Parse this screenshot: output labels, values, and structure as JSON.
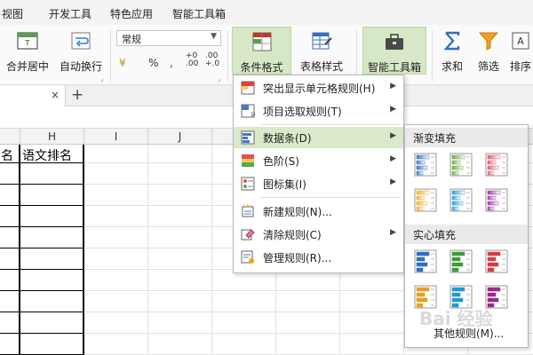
{
  "menu_tabs": [
    "视图",
    "开发工具",
    "特色应用",
    "智能工具箱"
  ],
  "ribbon": {
    "merge_center": "合并居中",
    "wrap_text": "自动换行",
    "number_format": "常规",
    "format_symbols": {
      "percent": "%",
      "comma": ",",
      "increase_decimal": "+0\n.00",
      "decrease_decimal": ".00\n+.0",
      "currency": "¥"
    },
    "conditional_format": "条件格式",
    "table_style": "表格样式",
    "smart_toolbox": "智能工具箱",
    "sum": "求和",
    "filter": "筛选",
    "sort": "排序"
  },
  "doc_tab": {
    "close": "×",
    "add": "+"
  },
  "columns": [
    "H",
    "I",
    "J"
  ],
  "cells": {
    "g_header": "名",
    "h_header": "语文排名"
  },
  "cf_menu": [
    {
      "label": "突出显示单元格规则(H)",
      "submenu": true,
      "icon": "highlight-rules-icon"
    },
    {
      "label": "项目选取规则(T)",
      "submenu": true,
      "icon": "top-bottom-rules-icon"
    },
    {
      "label": "数据条(D)",
      "submenu": true,
      "icon": "data-bars-icon",
      "selected": true
    },
    {
      "label": "色阶(S)",
      "submenu": true,
      "icon": "color-scales-icon"
    },
    {
      "label": "图标集(I)",
      "submenu": true,
      "icon": "icon-sets-icon"
    },
    {
      "label": "新建规则(N)...",
      "submenu": false,
      "icon": "new-rule-icon"
    },
    {
      "label": "清除规则(C)",
      "submenu": true,
      "icon": "clear-rules-icon"
    },
    {
      "label": "管理规则(R)...",
      "submenu": false,
      "icon": "manage-rules-icon"
    }
  ],
  "databar_submenu": {
    "gradient_fill": "渐变填充",
    "solid_fill": "实心填充",
    "more_rules": "其他规则(M)...",
    "gradient_colors": [
      "#4472c4",
      "#70ad47",
      "#e06070",
      "#f0b030",
      "#30a0e0",
      "#a040a0"
    ],
    "solid_colors": [
      "#2f6fc0",
      "#3d9a3d",
      "#d63c46",
      "#e8a020",
      "#1f9ad6",
      "#9c2a8c"
    ]
  },
  "watermark": "Bai 经验",
  "accent_color": "#d9e9c9"
}
